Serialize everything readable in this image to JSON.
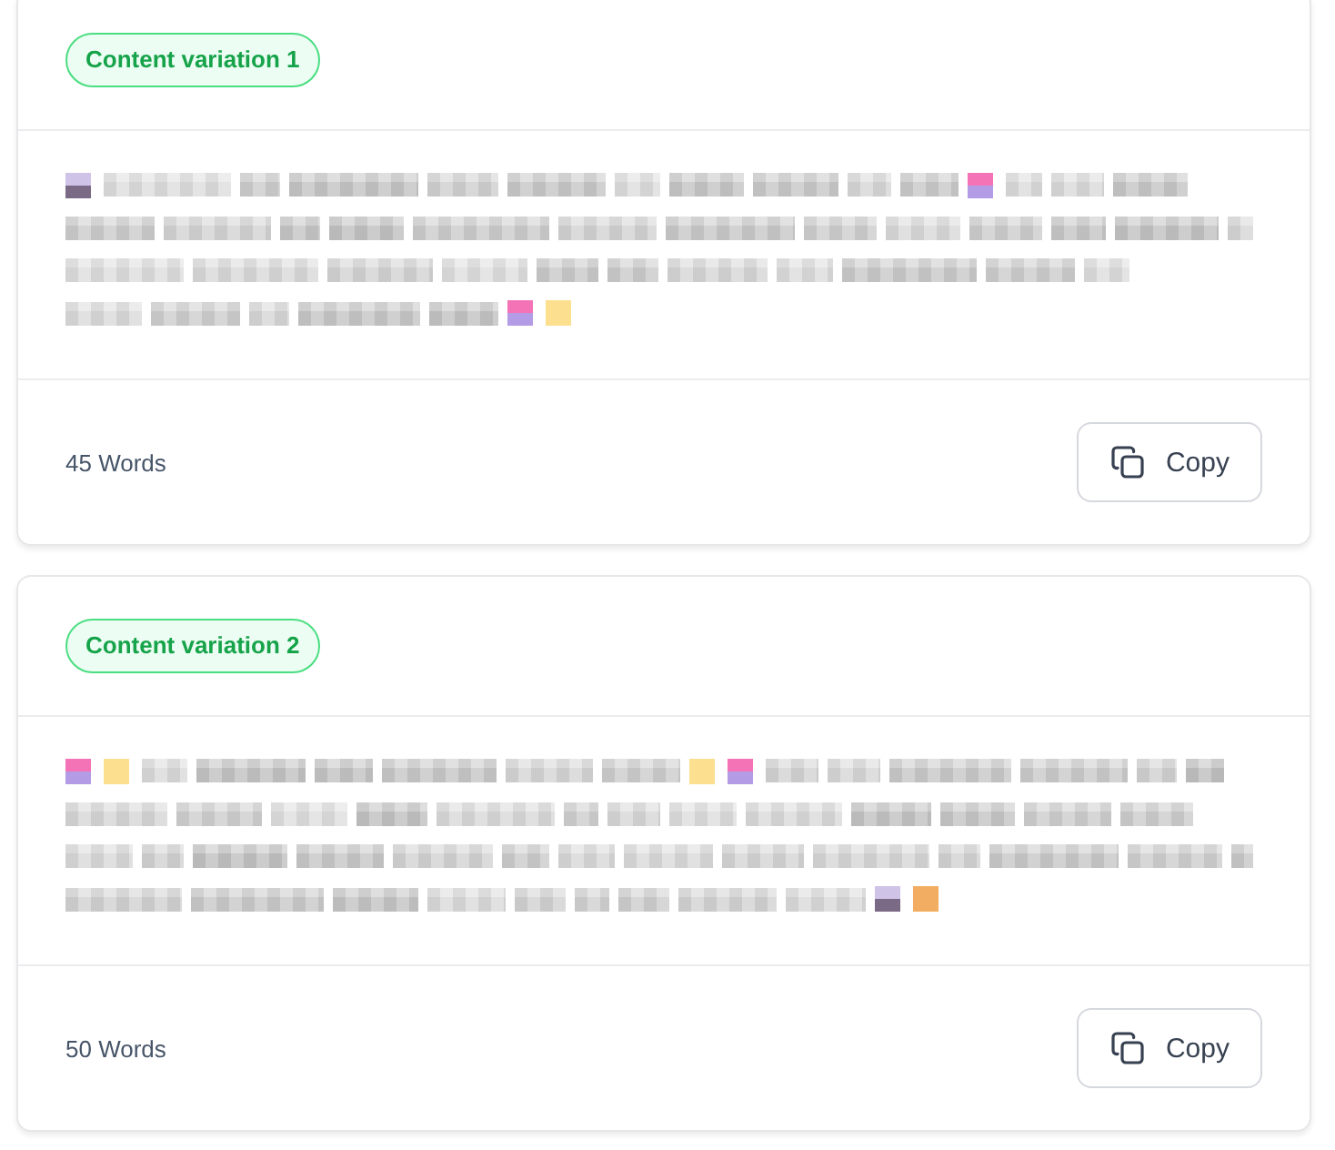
{
  "cards": [
    {
      "badge": "Content variation 1",
      "word_count": "45 Words",
      "copy_button": "Copy"
    },
    {
      "badge": "Content variation 2",
      "word_count": "50 Words",
      "copy_button": "Copy"
    }
  ]
}
